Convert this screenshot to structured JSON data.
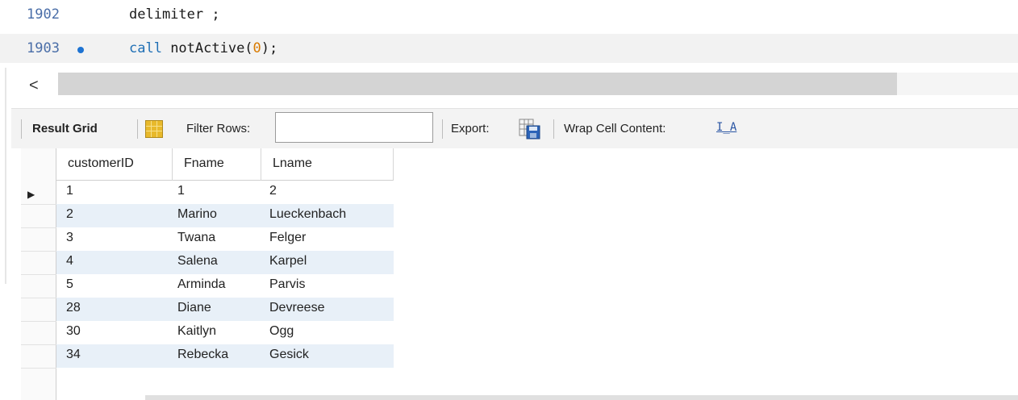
{
  "editor": {
    "lines": [
      {
        "number": "1902",
        "code": "delimiter ;",
        "has_breakpoint": false
      },
      {
        "number": "1903",
        "keyword": "call",
        "code_before": " notActive(",
        "arg": "0",
        "code_after": ");",
        "has_breakpoint": true
      }
    ]
  },
  "hscroll": {
    "left_arrow": "<"
  },
  "toolbar": {
    "result_grid_label": "Result Grid",
    "filter_rows_label": "Filter Rows:",
    "filter_rows_value": "",
    "export_label": "Export:",
    "wrap_cell_label": "Wrap Cell Content:",
    "wrap_icon_glyph": "I̲A",
    "icons": [
      "grid-layout-icon",
      "export-save-icon",
      "wrap-cell-icon"
    ]
  },
  "result_grid": {
    "columns": [
      "customerID",
      "Fname",
      "Lname"
    ],
    "rows": [
      {
        "customerID": "1",
        "Fname": "1",
        "Lname": "2"
      },
      {
        "customerID": "2",
        "Fname": "Marino",
        "Lname": "Lueckenbach"
      },
      {
        "customerID": "3",
        "Fname": "Twana",
        "Lname": "Felger"
      },
      {
        "customerID": "4",
        "Fname": "Salena",
        "Lname": "Karpel"
      },
      {
        "customerID": "5",
        "Fname": "Arminda",
        "Lname": "Parvis"
      },
      {
        "customerID": "28",
        "Fname": "Diane",
        "Lname": "Devreese"
      },
      {
        "customerID": "30",
        "Fname": "Kaitlyn",
        "Lname": "Ogg"
      },
      {
        "customerID": "34",
        "Fname": "Rebecka",
        "Lname": "Gesick"
      }
    ],
    "current_row_marker": "▶",
    "colors": {
      "alt_row": "#e8f0f8",
      "keyword": "#1f6fb5",
      "number": "#d97a00",
      "breakpoint": "#1e73d2"
    }
  }
}
